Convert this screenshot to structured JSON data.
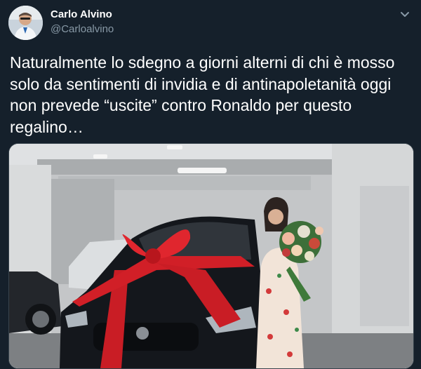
{
  "tweet": {
    "author": {
      "display_name": "Carlo Alvino",
      "handle": "@Carloalvino"
    },
    "text": "Naturalmente lo sdegno a giorni alterni di chi è mosso solo da sentimenti di invidia e di antinapoletanità oggi non prevede “uscite” contro Ronaldo per questo regalino…",
    "media": {
      "icon": "photo"
    }
  },
  "colors": {
    "background": "#15202b",
    "text_primary": "#ffffff",
    "text_secondary": "#8899a6",
    "border": "#38444d",
    "ribbon": "#d11f27",
    "car": "#14171c"
  }
}
